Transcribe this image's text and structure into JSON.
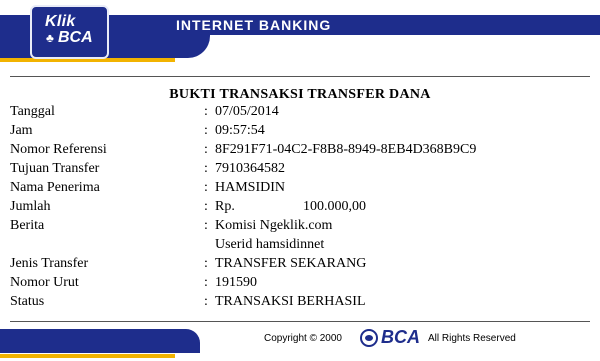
{
  "header": {
    "logo_line1": "Klik",
    "logo_line2": "BCA",
    "title": "INTERNET BANKING"
  },
  "receipt": {
    "title": "BUKTI TRANSAKSI TRANSFER DANA",
    "fields": [
      {
        "label": "Tanggal",
        "value": "07/05/2014"
      },
      {
        "label": "Jam",
        "value": "09:57:54"
      },
      {
        "label": "Nomor Referensi",
        "value": "8F291F71-04C2-F8B8-8949-8EB4D368B9C9"
      },
      {
        "label": "Tujuan Transfer",
        "value": "7910364582"
      },
      {
        "label": "Nama Penerima",
        "value": "HAMSIDIN"
      },
      {
        "label": "Jumlah",
        "currency": "Rp.",
        "amount": "100.000,00"
      },
      {
        "label": "Berita",
        "value": "Komisi Ngeklik.com",
        "value2": "Userid hamsidinnet"
      },
      {
        "label": "Jenis Transfer",
        "value": "TRANSFER SEKARANG"
      },
      {
        "label": "Nomor Urut",
        "value": "191590"
      },
      {
        "label": "Status",
        "value": "TRANSAKSI BERHASIL"
      }
    ],
    "colon": ":"
  },
  "footer": {
    "copyright": "Copyright © 2000",
    "logo_text": "BCA",
    "rights": "All Rights Reserved"
  },
  "colors": {
    "brand_blue": "#1e2d8c",
    "brand_yellow": "#f2b300"
  }
}
